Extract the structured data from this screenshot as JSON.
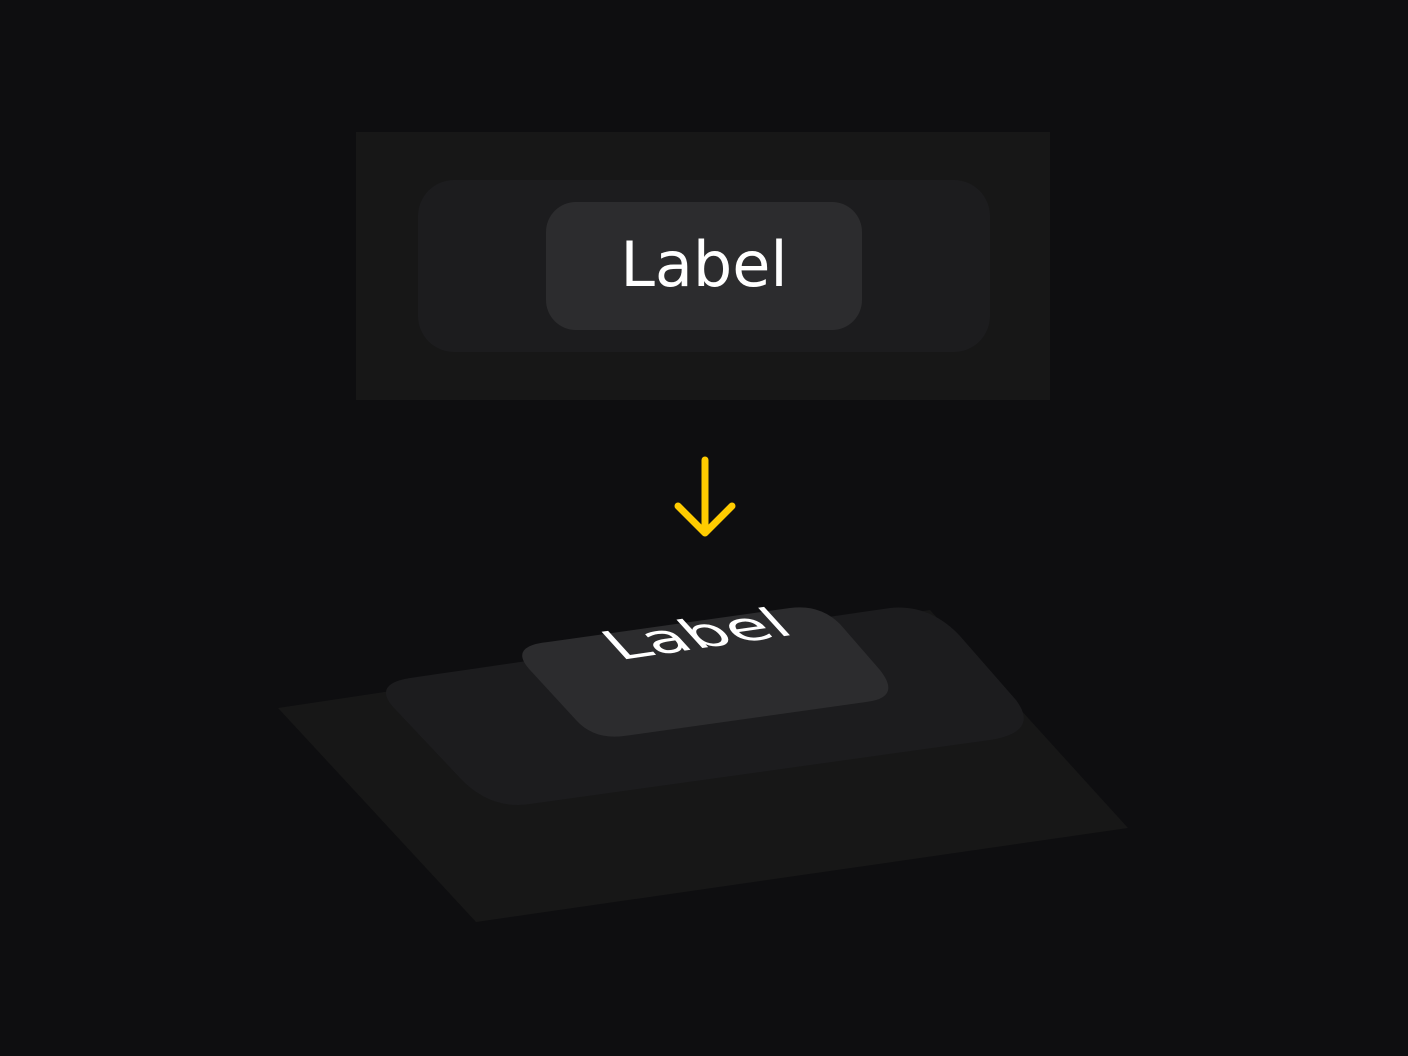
{
  "flat_view": {
    "label": "Label"
  },
  "isometric_view": {
    "label": "Label"
  },
  "colors": {
    "background": "#0e0e10",
    "outer_layer": "#171717",
    "middle_layer": "#1c1c1e",
    "inner_layer": "#2c2c2e",
    "label_text": "#ffffff",
    "arrow": "#ffcc00"
  },
  "icons": {
    "transition": "arrow-down-icon"
  }
}
